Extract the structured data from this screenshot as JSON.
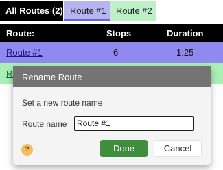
{
  "tabs": [
    {
      "label": "All Routes (2)"
    },
    {
      "label": "Route #1"
    },
    {
      "label": "Route #2"
    }
  ],
  "table": {
    "headers": {
      "route": "Route:",
      "stops": "Stops",
      "duration": "Duration"
    },
    "rows": [
      {
        "route": "Route #1",
        "stops": "6",
        "duration": "1:25"
      },
      {
        "route": "Ro",
        "stops": "",
        "duration": ""
      }
    ]
  },
  "dialog": {
    "title": "Rename Route",
    "prompt": "Set a new route name",
    "field_label": "Route name",
    "field_value": "Route #1",
    "help_label": "?",
    "done_label": "Done",
    "cancel_label": "Cancel"
  },
  "colors": {
    "tab_all": "#000000",
    "route1": "#8f89f0",
    "route2": "#a9efb6",
    "dialog_header": "#747474",
    "done_button": "#3e8e3d",
    "help_icon": "#f2be5e"
  }
}
